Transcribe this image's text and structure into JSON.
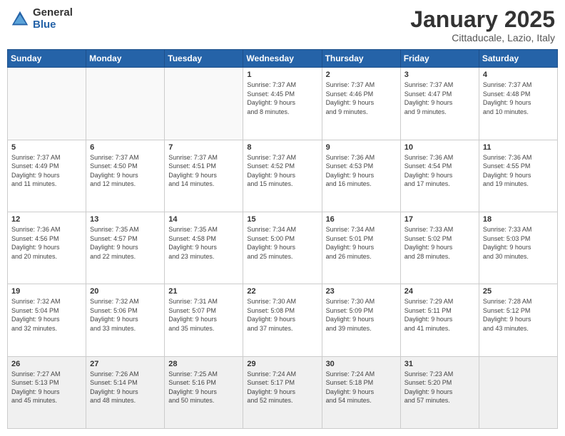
{
  "header": {
    "logo_general": "General",
    "logo_blue": "Blue",
    "month_title": "January 2025",
    "location": "Cittaducale, Lazio, Italy"
  },
  "weekdays": [
    "Sunday",
    "Monday",
    "Tuesday",
    "Wednesday",
    "Thursday",
    "Friday",
    "Saturday"
  ],
  "weeks": [
    [
      {
        "day": "",
        "info": ""
      },
      {
        "day": "",
        "info": ""
      },
      {
        "day": "",
        "info": ""
      },
      {
        "day": "1",
        "info": "Sunrise: 7:37 AM\nSunset: 4:45 PM\nDaylight: 9 hours\nand 8 minutes."
      },
      {
        "day": "2",
        "info": "Sunrise: 7:37 AM\nSunset: 4:46 PM\nDaylight: 9 hours\nand 9 minutes."
      },
      {
        "day": "3",
        "info": "Sunrise: 7:37 AM\nSunset: 4:47 PM\nDaylight: 9 hours\nand 9 minutes."
      },
      {
        "day": "4",
        "info": "Sunrise: 7:37 AM\nSunset: 4:48 PM\nDaylight: 9 hours\nand 10 minutes."
      }
    ],
    [
      {
        "day": "5",
        "info": "Sunrise: 7:37 AM\nSunset: 4:49 PM\nDaylight: 9 hours\nand 11 minutes."
      },
      {
        "day": "6",
        "info": "Sunrise: 7:37 AM\nSunset: 4:50 PM\nDaylight: 9 hours\nand 12 minutes."
      },
      {
        "day": "7",
        "info": "Sunrise: 7:37 AM\nSunset: 4:51 PM\nDaylight: 9 hours\nand 14 minutes."
      },
      {
        "day": "8",
        "info": "Sunrise: 7:37 AM\nSunset: 4:52 PM\nDaylight: 9 hours\nand 15 minutes."
      },
      {
        "day": "9",
        "info": "Sunrise: 7:36 AM\nSunset: 4:53 PM\nDaylight: 9 hours\nand 16 minutes."
      },
      {
        "day": "10",
        "info": "Sunrise: 7:36 AM\nSunset: 4:54 PM\nDaylight: 9 hours\nand 17 minutes."
      },
      {
        "day": "11",
        "info": "Sunrise: 7:36 AM\nSunset: 4:55 PM\nDaylight: 9 hours\nand 19 minutes."
      }
    ],
    [
      {
        "day": "12",
        "info": "Sunrise: 7:36 AM\nSunset: 4:56 PM\nDaylight: 9 hours\nand 20 minutes."
      },
      {
        "day": "13",
        "info": "Sunrise: 7:35 AM\nSunset: 4:57 PM\nDaylight: 9 hours\nand 22 minutes."
      },
      {
        "day": "14",
        "info": "Sunrise: 7:35 AM\nSunset: 4:58 PM\nDaylight: 9 hours\nand 23 minutes."
      },
      {
        "day": "15",
        "info": "Sunrise: 7:34 AM\nSunset: 5:00 PM\nDaylight: 9 hours\nand 25 minutes."
      },
      {
        "day": "16",
        "info": "Sunrise: 7:34 AM\nSunset: 5:01 PM\nDaylight: 9 hours\nand 26 minutes."
      },
      {
        "day": "17",
        "info": "Sunrise: 7:33 AM\nSunset: 5:02 PM\nDaylight: 9 hours\nand 28 minutes."
      },
      {
        "day": "18",
        "info": "Sunrise: 7:33 AM\nSunset: 5:03 PM\nDaylight: 9 hours\nand 30 minutes."
      }
    ],
    [
      {
        "day": "19",
        "info": "Sunrise: 7:32 AM\nSunset: 5:04 PM\nDaylight: 9 hours\nand 32 minutes."
      },
      {
        "day": "20",
        "info": "Sunrise: 7:32 AM\nSunset: 5:06 PM\nDaylight: 9 hours\nand 33 minutes."
      },
      {
        "day": "21",
        "info": "Sunrise: 7:31 AM\nSunset: 5:07 PM\nDaylight: 9 hours\nand 35 minutes."
      },
      {
        "day": "22",
        "info": "Sunrise: 7:30 AM\nSunset: 5:08 PM\nDaylight: 9 hours\nand 37 minutes."
      },
      {
        "day": "23",
        "info": "Sunrise: 7:30 AM\nSunset: 5:09 PM\nDaylight: 9 hours\nand 39 minutes."
      },
      {
        "day": "24",
        "info": "Sunrise: 7:29 AM\nSunset: 5:11 PM\nDaylight: 9 hours\nand 41 minutes."
      },
      {
        "day": "25",
        "info": "Sunrise: 7:28 AM\nSunset: 5:12 PM\nDaylight: 9 hours\nand 43 minutes."
      }
    ],
    [
      {
        "day": "26",
        "info": "Sunrise: 7:27 AM\nSunset: 5:13 PM\nDaylight: 9 hours\nand 45 minutes."
      },
      {
        "day": "27",
        "info": "Sunrise: 7:26 AM\nSunset: 5:14 PM\nDaylight: 9 hours\nand 48 minutes."
      },
      {
        "day": "28",
        "info": "Sunrise: 7:25 AM\nSunset: 5:16 PM\nDaylight: 9 hours\nand 50 minutes."
      },
      {
        "day": "29",
        "info": "Sunrise: 7:24 AM\nSunset: 5:17 PM\nDaylight: 9 hours\nand 52 minutes."
      },
      {
        "day": "30",
        "info": "Sunrise: 7:24 AM\nSunset: 5:18 PM\nDaylight: 9 hours\nand 54 minutes."
      },
      {
        "day": "31",
        "info": "Sunrise: 7:23 AM\nSunset: 5:20 PM\nDaylight: 9 hours\nand 57 minutes."
      },
      {
        "day": "",
        "info": ""
      }
    ]
  ]
}
